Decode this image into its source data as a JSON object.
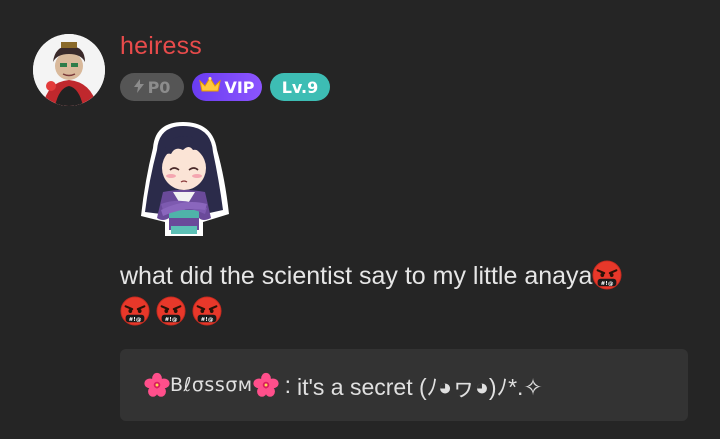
{
  "message": {
    "username": "heiress",
    "badges": {
      "power": "P0",
      "vip": "VIP",
      "level": "Lv.9"
    },
    "text": "what did the scientist say to my little anaya",
    "emoji": "enraged-face-with-symbols",
    "reply": {
      "author": "Bℓσѕѕσм",
      "separator": ":",
      "text": "it's a secret (ﾉ◕ヮ◕)ﾉ*.✧"
    }
  },
  "colors": {
    "background": "#252525",
    "username": "#e84b4b",
    "vip_badge": "#7b48f8",
    "level_badge": "#3dbdb4",
    "reply_box": "#333333"
  }
}
